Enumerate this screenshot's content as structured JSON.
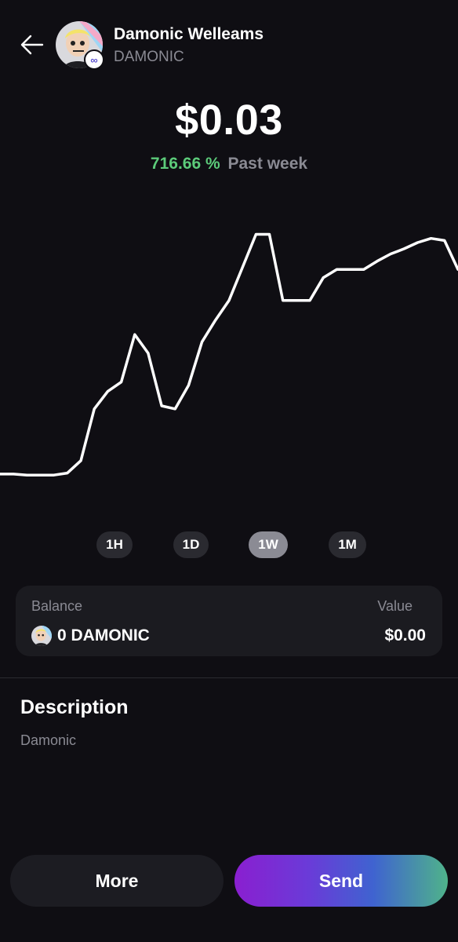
{
  "header": {
    "name": "Damonic Welleams",
    "ticker": "DAMONIC",
    "avatar_badge": "∞"
  },
  "price": {
    "value": "$0.03",
    "change_percent": "716.66 %",
    "change_period": "Past week",
    "change_color": "#5ccb7a"
  },
  "chart_data": {
    "type": "line",
    "color": "#ffffff",
    "grid": false,
    "series": [
      {
        "values": [
          0.0032,
          0.0032,
          0.0031,
          0.0031,
          0.0031,
          0.0033,
          0.0045,
          0.0095,
          0.0112,
          0.0121,
          0.0167,
          0.0149,
          0.0098,
          0.0095,
          0.0118,
          0.016,
          0.0181,
          0.02,
          0.0232,
          0.0264,
          0.0264,
          0.02,
          0.02,
          0.02,
          0.0222,
          0.023,
          0.023,
          0.023,
          0.0238,
          0.0245,
          0.025,
          0.0256,
          0.026,
          0.0258,
          0.023
        ]
      }
    ]
  },
  "ranges": {
    "items": [
      "1H",
      "1D",
      "1W",
      "1M"
    ],
    "active": "1W"
  },
  "balance": {
    "balance_label": "Balance",
    "value_label": "Value",
    "amount": "0 DAMONIC",
    "value": "$0.00"
  },
  "description": {
    "title": "Description",
    "text": "Damonic"
  },
  "actions": {
    "more_label": "More",
    "send_label": "Send"
  }
}
